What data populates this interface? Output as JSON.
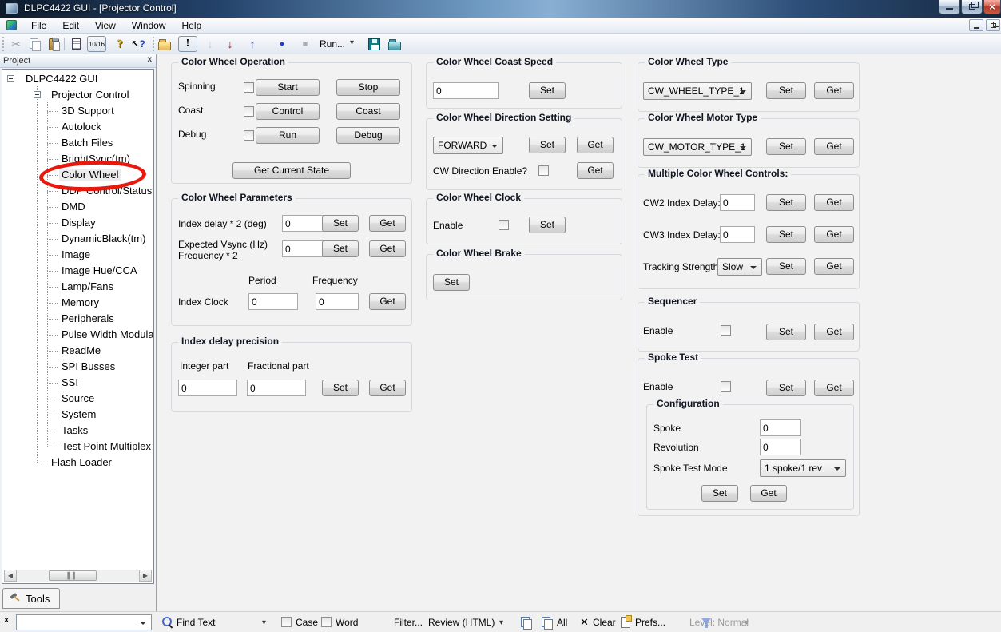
{
  "window": {
    "title": "DLPC4422 GUI - [Projector Control]"
  },
  "menu": {
    "items": [
      "File",
      "Edit",
      "View",
      "Window",
      "Help"
    ]
  },
  "toolbar": {
    "run_label": "Run...",
    "fraction_label": "10/16",
    "excl_label": "!"
  },
  "common": {
    "set": "Set",
    "get": "Get"
  },
  "colors": {
    "annotation_red": "#e8180c",
    "close_button_red": "#b13a28"
  },
  "sidebar": {
    "panel_title": "Project",
    "tools_tab": "Tools",
    "tree": {
      "root": "DLPC4422 GUI",
      "parent": "Projector Control",
      "selected": "Color Wheel",
      "children": [
        "3D Support",
        "Autolock",
        "Batch Files",
        "BrightSync(tm)",
        "Color Wheel",
        "DDP Control/Status",
        "DMD",
        "Display",
        "DynamicBlack(tm)",
        "Image",
        "Image Hue/CCA",
        "Lamp/Fans",
        "Memory",
        "Peripherals",
        "Pulse Width Modula",
        "ReadMe",
        "SPI Busses",
        "SSI",
        "Source",
        "System",
        "Tasks",
        "Test Point Multiplex"
      ],
      "flash_loader": "Flash Loader"
    }
  },
  "groups": {
    "operation": {
      "title": "Color Wheel Operation",
      "rows": [
        {
          "label": "Spinning",
          "btn1": "Start",
          "btn2": "Stop"
        },
        {
          "label": "Coast",
          "btn1": "Control",
          "btn2": "Coast"
        },
        {
          "label": "Debug",
          "btn1": "Run",
          "btn2": "Debug"
        }
      ],
      "get_state": "Get Current State"
    },
    "parameters": {
      "title": "Color Wheel Parameters",
      "index_delay_label": "Index delay * 2 (deg)",
      "index_delay_value": "0",
      "vsync_label_1": "Expected Vsync (Hz)",
      "vsync_label_2": "Frequency * 2",
      "vsync_value": "0",
      "period_header": "Period",
      "frequency_header": "Frequency",
      "index_clock_label": "Index Clock",
      "period_value": "0",
      "frequency_value": "0"
    },
    "precision": {
      "title": "Index delay precision",
      "integer_header": "Integer part",
      "fractional_header": "Fractional part",
      "integer_value": "0",
      "fractional_value": "0"
    },
    "coast_speed": {
      "title": "Color Wheel Coast Speed",
      "value": "0"
    },
    "direction": {
      "title": "Color Wheel Direction Setting",
      "value": "FORWARD",
      "enable_label": "CW Direction Enable?"
    },
    "clock": {
      "title": "Color Wheel Clock",
      "enable_label": "Enable"
    },
    "brake": {
      "title": "Color Wheel Brake"
    },
    "wheel_type": {
      "title": "Color Wheel Type",
      "value": "CW_WHEEL_TYPE_1"
    },
    "motor_type": {
      "title": "Color Wheel Motor Type",
      "value": "CW_MOTOR_TYPE_1"
    },
    "multi": {
      "title": "Multiple Color Wheel Controls:",
      "cw2_label": "CW2 Index Delay:",
      "cw2_value": "0",
      "cw3_label": "CW3 Index Delay:",
      "cw3_value": "0",
      "tracking_label": "Tracking Strength:",
      "tracking_value": "Slow"
    },
    "sequencer": {
      "title": "Sequencer",
      "enable_label": "Enable"
    },
    "spoke_test": {
      "title": "Spoke Test",
      "enable_label": "Enable",
      "config": {
        "title": "Configuration",
        "spoke_label": "Spoke",
        "spoke_value": "0",
        "revolution_label": "Revolution",
        "revolution_value": "0",
        "mode_label": "Spoke Test Mode",
        "mode_value": "1 spoke/1 rev"
      }
    }
  },
  "findbar": {
    "find_text": "Find Text",
    "case_label": "Case",
    "word_label": "Word",
    "filter_label": "Filter...",
    "review_label": "Review (HTML)",
    "all_label": "All",
    "clear_label": "Clear",
    "prefs_label": "Prefs...",
    "level_label": "Level: Normal"
  }
}
